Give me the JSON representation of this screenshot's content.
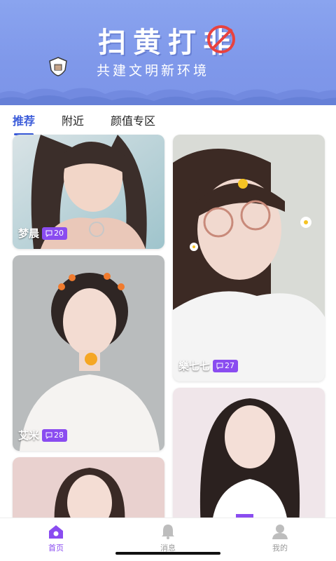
{
  "banner": {
    "title": "扫黄打",
    "title_strike_char": "非",
    "subtitle": "共建文明新环境",
    "bg_color": "#7f98ea",
    "icon": "shield-fist-icon"
  },
  "tabs": [
    {
      "label": "推荐",
      "active": true
    },
    {
      "label": "附近",
      "active": false
    },
    {
      "label": "颜值专区",
      "active": false
    }
  ],
  "cards": [
    {
      "name": "梦晨",
      "count": "20"
    },
    {
      "name": "艾米",
      "count": "28"
    },
    {
      "name": "",
      "count": ""
    },
    {
      "name": "樂七七",
      "count": "27"
    },
    {
      "name": "",
      "count": ""
    }
  ],
  "bottom_nav": [
    {
      "label": "首页",
      "icon": "home-icon",
      "active": true
    },
    {
      "label": "消息",
      "icon": "bell-icon",
      "active": false
    },
    {
      "label": "我的",
      "icon": "user-icon",
      "active": false
    }
  ],
  "colors": {
    "accent_tab": "#3a5bd9",
    "badge": "#8a4cf0",
    "nav_active": "#8a4cf0",
    "nav_inactive": "#bdbdbd"
  }
}
